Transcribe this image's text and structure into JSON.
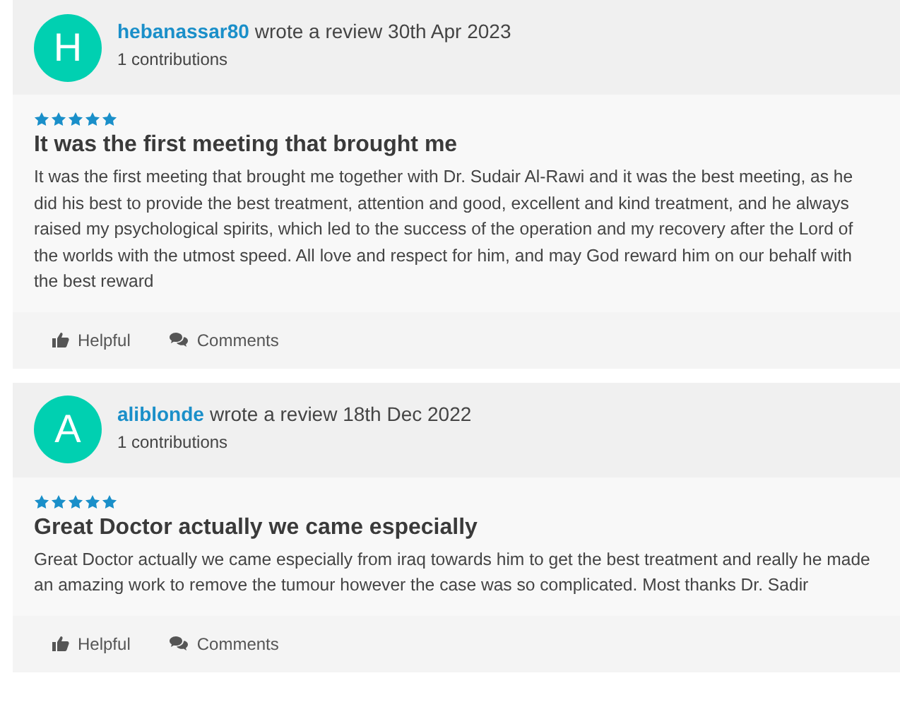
{
  "reviews": [
    {
      "initial": "H",
      "username": "hebanassar80",
      "action": "wrote a review 30th Apr 2023",
      "contributions": "1 contributions",
      "stars": 5,
      "title": "It was the first meeting that brought me",
      "body": "It was the first meeting that brought me together with Dr. Sudair Al-Rawi and it was the best meeting, as he did his best to provide the best treatment, attention and good, excellent and kind treatment, and he always raised my psychological spirits, which led to the success of the operation and my recovery after the Lord of the worlds with the utmost speed. All love and respect for him, and may God reward him on our behalf with the best reward",
      "helpful": "Helpful",
      "comments": "Comments"
    },
    {
      "initial": "A",
      "username": "aliblonde",
      "action": "wrote a review 18th Dec 2022",
      "contributions": "1 contributions",
      "stars": 5,
      "title": "Great Doctor actually we came especially",
      "body": "Great Doctor actually we came especially from iraq towards him to get the best treatment and really he made an amazing work to remove the tumour however the case was so complicated. Most thanks Dr. Sadir",
      "helpful": "Helpful",
      "comments": "Comments"
    }
  ]
}
